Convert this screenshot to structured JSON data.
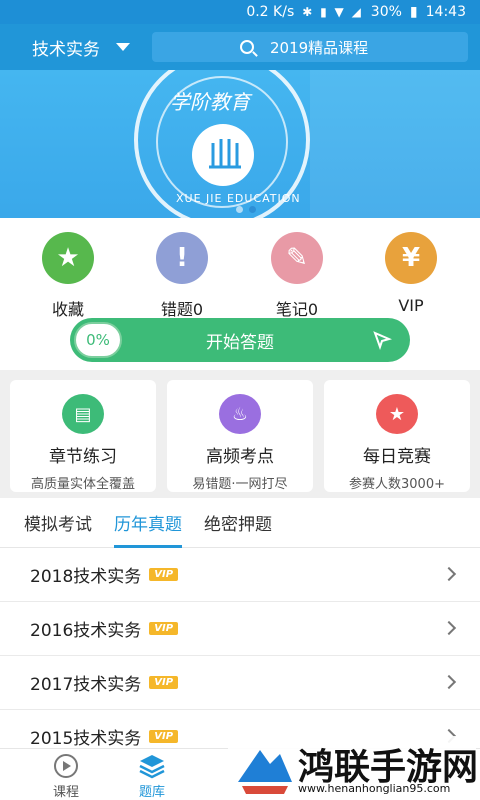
{
  "status_bar": {
    "speed": "0.2 K/s",
    "battery": "30%",
    "time": "14:43"
  },
  "header": {
    "subject": "技术实务",
    "search_text": "2019精品课程"
  },
  "banner": {
    "logo_top": "学阶教育",
    "logo_arc": "XUE JIE EDUCATION",
    "dots": 2,
    "active_dot": 1
  },
  "quick_actions": [
    {
      "label": "收藏",
      "icon": "star-icon",
      "color": "#57b84d"
    },
    {
      "label": "错题0",
      "icon": "exclamation-icon",
      "color": "#8f9fd6"
    },
    {
      "label": "笔记0",
      "icon": "pencil-icon",
      "color": "#e89aa6"
    },
    {
      "label": "VIP",
      "icon": "yen-refresh-icon",
      "color": "#e8a23c"
    }
  ],
  "start_button": {
    "progress": "0%",
    "label": "开始答题"
  },
  "cards": [
    {
      "title": "章节练习",
      "subtitle": "高质量实体全覆盖",
      "icon": "document-icon",
      "color": "#3dbb78"
    },
    {
      "title": "高频考点",
      "subtitle": "易错题·一网打尽",
      "icon": "flame-icon",
      "color": "#9a6fe0"
    },
    {
      "title": "每日竞赛",
      "subtitle": "参赛人数3000+",
      "icon": "medal-icon",
      "color": "#ee5a5a"
    }
  ],
  "tabs": [
    {
      "label": "模拟考试",
      "active": false
    },
    {
      "label": "历年真题",
      "active": true
    },
    {
      "label": "绝密押题",
      "active": false
    }
  ],
  "list": [
    {
      "title": "2018技术实务",
      "badge": "VIP"
    },
    {
      "title": "2016技术实务",
      "badge": "VIP"
    },
    {
      "title": "2017技术实务",
      "badge": "VIP"
    },
    {
      "title": "2015技术实务",
      "badge": "VIP"
    }
  ],
  "bottom_nav": [
    {
      "label": "课程",
      "icon": "play-icon",
      "active": false
    },
    {
      "label": "题库",
      "icon": "layers-icon",
      "active": true
    }
  ],
  "watermark": {
    "title": "鸿联手游网",
    "url": "www.henanhonglian95.com"
  }
}
